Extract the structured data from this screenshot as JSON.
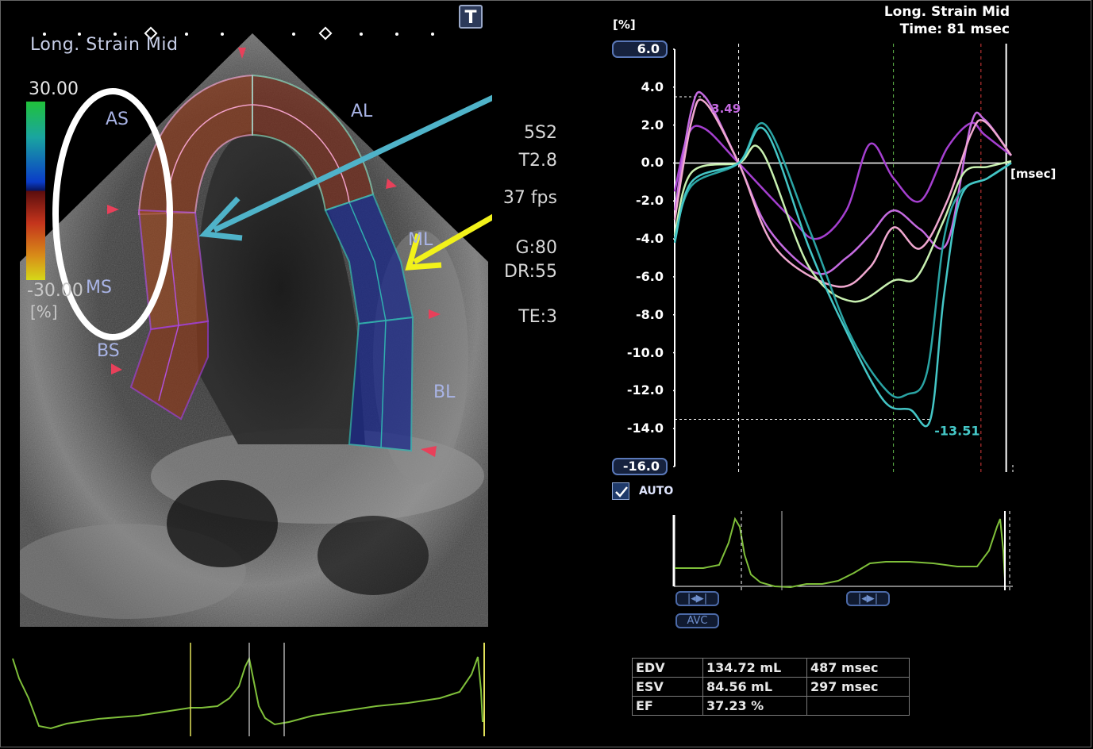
{
  "echo": {
    "view_label": "Long. Strain Mid",
    "t_button": "T",
    "scale": {
      "max": "30.00",
      "min": "-30.00",
      "unit": "[%]"
    },
    "segments": {
      "AS": "AS",
      "MS": "MS",
      "BS": "BS",
      "AL": "AL",
      "ML": "ML",
      "BL": "BL"
    },
    "params": {
      "probe": "5S2",
      "tissue": "T2.8",
      "frame_rate": "37 fps",
      "gain": "G:80",
      "dynamic_range": "DR:55",
      "te": "TE:3"
    }
  },
  "chart": {
    "title": "Long. Strain Mid",
    "time_readout": "Time: 81 msec",
    "y_unit": "[%]",
    "x_unit": "[msec]",
    "ymax_button": "6.0",
    "ymin_button": "-16.0",
    "ticks": [
      "4.0",
      "2.0",
      "0.0",
      "-2.0",
      "-4.0",
      "-6.0",
      "-8.0",
      "-10.0",
      "-12.0",
      "-14.0"
    ],
    "peak_pos_label": "3.49",
    "peak_neg_label": "-13.51",
    "auto_label": "AUTO",
    "avc_label": "AVC",
    "colors": {
      "purple": "#a53fd0",
      "violet": "#c46ae0",
      "pink": "#f0a8d0",
      "lightgreen": "#c8f0b0",
      "teal": "#2aa4a4",
      "teal2": "#44c6c6"
    }
  },
  "chart_data": {
    "type": "line",
    "title": "Long. Strain Mid",
    "ylabel": "[%]",
    "xlabel": "[msec]",
    "ylim": [
      -16,
      6
    ],
    "xlim": [
      0,
      1
    ],
    "grid": false,
    "series": [
      {
        "color": "#a53fd0",
        "x": [
          0,
          0.04,
          0.09,
          0.19,
          0.34,
          0.42,
          0.51,
          0.58,
          0.65,
          0.73,
          0.81,
          0.88,
          0.92,
          1
        ],
        "y": [
          -1.5,
          1.5,
          1.8,
          0,
          -2.8,
          -4,
          -2.5,
          1,
          -0.8,
          -2,
          0.8,
          2.1,
          1.5,
          0.4
        ]
      },
      {
        "color": "#c46ae0",
        "x": [
          0,
          0.05,
          0.09,
          0.19,
          0.28,
          0.42,
          0.51,
          0.58,
          0.65,
          0.73,
          0.81,
          0.88,
          0.92,
          1
        ],
        "y": [
          -2.5,
          2.8,
          3.49,
          0,
          -3.5,
          -5.8,
          -5,
          -3.8,
          -2.5,
          -3.5,
          -4.2,
          2,
          2.3,
          0.4
        ]
      },
      {
        "color": "#f0a8d0",
        "x": [
          0,
          0.05,
          0.09,
          0.19,
          0.3,
          0.48,
          0.58,
          0.65,
          0.73,
          0.81,
          0.88,
          0.92,
          1
        ],
        "y": [
          -3,
          2.2,
          3.2,
          0,
          -4.5,
          -6.5,
          -5.5,
          -3.4,
          -4.5,
          -2,
          1.5,
          2.2,
          0.4
        ]
      },
      {
        "color": "#c8f0b0",
        "x": [
          0,
          0.05,
          0.19,
          0.26,
          0.4,
          0.53,
          0.65,
          0.72,
          0.8,
          0.86,
          0.93,
          1
        ],
        "y": [
          -3.8,
          -0.5,
          0,
          0.6,
          -5.5,
          -7.3,
          -6.2,
          -6,
          -3,
          -0.5,
          -0.2,
          0.1
        ]
      },
      {
        "color": "#2aa4a4",
        "x": [
          0,
          0.05,
          0.19,
          0.27,
          0.4,
          0.52,
          0.63,
          0.69,
          0.75,
          0.8,
          0.85,
          0.93,
          1
        ],
        "y": [
          -4,
          -1.2,
          0,
          2,
          -3.5,
          -9,
          -12,
          -12.2,
          -11,
          -4,
          -1.5,
          -0.8,
          0
        ]
      },
      {
        "color": "#44c6c6",
        "x": [
          0,
          0.05,
          0.19,
          0.27,
          0.4,
          0.5,
          0.62,
          0.7,
          0.76,
          0.8,
          0.85,
          0.93,
          1
        ],
        "y": [
          -4.2,
          -1,
          0,
          1.7,
          -4.5,
          -8.5,
          -12.5,
          -13,
          -13.51,
          -7,
          -1.8,
          -0.8,
          0
        ]
      }
    ],
    "peak_labels": [
      "3.49",
      "-13.51"
    ]
  },
  "results": {
    "rows": [
      {
        "name": "EDV",
        "value": "134.72 mL",
        "time": "487 msec"
      },
      {
        "name": "ESV",
        "value": "84.56 mL",
        "time": "297 msec"
      },
      {
        "name": "EF",
        "value": "37.23 %",
        "time": ""
      }
    ]
  }
}
